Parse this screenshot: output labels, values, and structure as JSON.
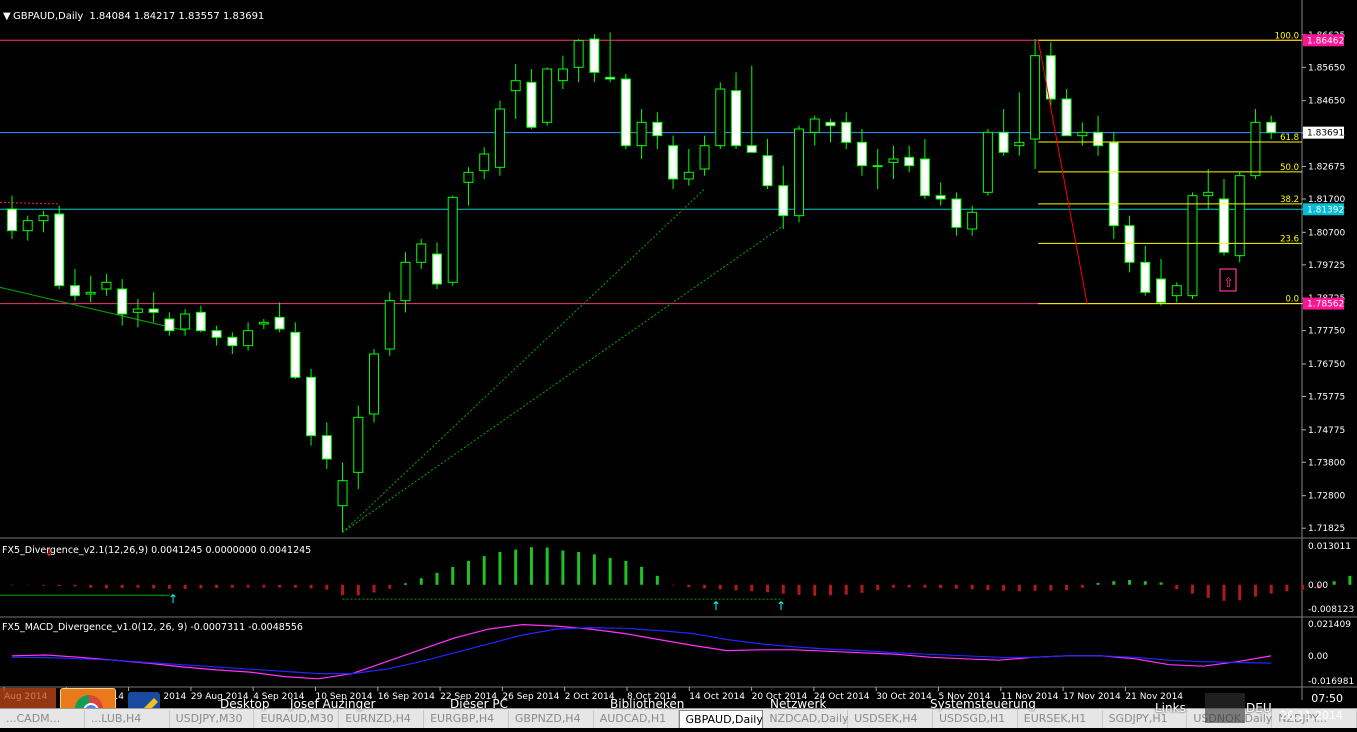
{
  "window": {
    "title": "GBPAUD,Daily",
    "ohlc": "1.84084 1.84217 1.83557 1.83691"
  },
  "colors": {
    "bull": "#00ff00",
    "body_fill": "#ffffff",
    "fib_line": "#ffff00",
    "hline_magenta": "#ff3377",
    "hline_blue": "#3399ff",
    "hline_cyan": "#00cccc",
    "hist_up": "#21c221",
    "hist_down": "#b0191d",
    "macd_main": "#ff33ff",
    "macd_signal": "#2424ff",
    "trend_dash": "#00aa00",
    "fib_trend": "#ff0000",
    "price_tag_magenta": "#ff1493",
    "price_tag_cyan": "#00bcd4"
  },
  "chart_data": [
    {
      "type": "candlestick",
      "title": "GBPAUD,Daily",
      "y_ticks": [
        "1.86625",
        "1.85650",
        "1.84650",
        "1.83691",
        "1.82675",
        "1.81700",
        "1.81392",
        "1.80700",
        "1.79725",
        "1.78725",
        "1.78562",
        "1.77750",
        "1.76750",
        "1.75775",
        "1.74775",
        "1.73800",
        "1.72800",
        "1.71825"
      ],
      "x_ticks": [
        "Aug 2014",
        "19 Aug 2014",
        "25 Aug 2014",
        "29 Aug 2014",
        "4 Sep 2014",
        "10 Sep 2014",
        "16 Sep 2014",
        "22 Sep 2014",
        "26 Sep 2014",
        "2 Oct 2014",
        "8 Oct 2014",
        "14 Oct 2014",
        "20 Oct 2014",
        "24 Oct 2014",
        "30 Oct 2014",
        "5 Nov 2014",
        "11 Nov 2014",
        "17 Nov 2014",
        "21 Nov 2014"
      ],
      "ylim": [
        1.7165,
        1.8695
      ],
      "current_price": "1.83691",
      "price_tags": [
        {
          "label": "1.86462",
          "value": 1.86462,
          "color": "magenta"
        },
        {
          "label": "1.83691",
          "value": 1.83691,
          "color": "white"
        },
        {
          "label": "1.81392",
          "value": 1.81392,
          "color": "cyan"
        },
        {
          "label": "1.78562",
          "value": 1.78562,
          "color": "magenta"
        }
      ],
      "horizontal_lines": [
        {
          "value": 1.86462,
          "color": "magenta"
        },
        {
          "value": 1.83691,
          "color": "blue"
        },
        {
          "value": 1.81392,
          "color": "cyan"
        },
        {
          "value": 1.78562,
          "color": "magenta"
        }
      ],
      "fibonacci": [
        {
          "label": "100.0",
          "value": 1.86462
        },
        {
          "label": "61.8",
          "value": 1.8341
        },
        {
          "label": "50.0",
          "value": 1.82512
        },
        {
          "label": "38.2",
          "value": 1.81553
        },
        {
          "label": "23.6",
          "value": 1.80369
        },
        {
          "label": "0.0",
          "value": 1.78562
        }
      ],
      "candles": [
        [
          1.814,
          1.818,
          1.805,
          1.8075
        ],
        [
          1.8075,
          1.812,
          1.8045,
          1.8105
        ],
        [
          1.8105,
          1.8135,
          1.807,
          1.812
        ],
        [
          1.8125,
          1.815,
          1.79,
          1.791
        ],
        [
          1.791,
          1.796,
          1.7865,
          1.788
        ],
        [
          1.7885,
          1.794,
          1.786,
          1.789
        ],
        [
          1.79,
          1.7945,
          1.788,
          1.792
        ],
        [
          1.79,
          1.793,
          1.779,
          1.7825
        ],
        [
          1.783,
          1.787,
          1.7785,
          1.784
        ],
        [
          1.784,
          1.789,
          1.78,
          1.783
        ],
        [
          1.781,
          1.783,
          1.776,
          1.7775
        ],
        [
          1.778,
          1.784,
          1.776,
          1.7825
        ],
        [
          1.783,
          1.785,
          1.777,
          1.7775
        ],
        [
          1.7775,
          1.779,
          1.773,
          1.7755
        ],
        [
          1.7755,
          1.777,
          1.7705,
          1.773
        ],
        [
          1.773,
          1.78,
          1.7715,
          1.7775
        ],
        [
          1.7795,
          1.781,
          1.778,
          1.78
        ],
        [
          1.7815,
          1.786,
          1.777,
          1.778
        ],
        [
          1.777,
          1.78,
          1.763,
          1.7635
        ],
        [
          1.7635,
          1.766,
          1.743,
          1.746
        ],
        [
          1.746,
          1.75,
          1.736,
          1.739
        ],
        [
          1.725,
          1.738,
          1.717,
          1.7325
        ],
        [
          1.735,
          1.755,
          1.73,
          1.7515
        ],
        [
          1.7525,
          1.772,
          1.75,
          1.7705
        ],
        [
          1.772,
          1.789,
          1.77,
          1.7865
        ],
        [
          1.7865,
          1.801,
          1.783,
          1.798
        ],
        [
          1.798,
          1.805,
          1.796,
          1.8035
        ],
        [
          1.8005,
          1.804,
          1.79,
          1.7915
        ],
        [
          1.792,
          1.818,
          1.791,
          1.8175
        ],
        [
          1.822,
          1.8265,
          1.815,
          1.825
        ],
        [
          1.8255,
          1.8325,
          1.823,
          1.8305
        ],
        [
          1.8265,
          1.8465,
          1.824,
          1.844
        ],
        [
          1.8495,
          1.8575,
          1.841,
          1.8525
        ],
        [
          1.852,
          1.856,
          1.838,
          1.8385
        ],
        [
          1.84,
          1.8565,
          1.839,
          1.856
        ],
        [
          1.8525,
          1.86,
          1.85,
          1.856
        ],
        [
          1.8565,
          1.865,
          1.852,
          1.8645
        ],
        [
          1.865,
          1.8665,
          1.852,
          1.855
        ],
        [
          1.8535,
          1.867,
          1.852,
          1.853
        ],
        [
          1.853,
          1.8545,
          1.832,
          1.833
        ],
        [
          1.833,
          1.844,
          1.829,
          1.84
        ],
        [
          1.84,
          1.843,
          1.832,
          1.836
        ],
        [
          1.833,
          1.836,
          1.82,
          1.823
        ],
        [
          1.823,
          1.832,
          1.821,
          1.825
        ],
        [
          1.826,
          1.836,
          1.824,
          1.833
        ],
        [
          1.833,
          1.852,
          1.832,
          1.85
        ],
        [
          1.8495,
          1.855,
          1.832,
          1.833
        ],
        [
          1.833,
          1.857,
          1.831,
          1.831
        ],
        [
          1.83,
          1.835,
          1.82,
          1.821
        ],
        [
          1.821,
          1.827,
          1.808,
          1.812
        ],
        [
          1.812,
          1.839,
          1.81,
          1.838
        ],
        [
          1.837,
          1.842,
          1.833,
          1.841
        ],
        [
          1.84,
          1.841,
          1.834,
          1.839
        ],
        [
          1.84,
          1.843,
          1.832,
          1.834
        ],
        [
          1.834,
          1.838,
          1.824,
          1.827
        ],
        [
          1.827,
          1.832,
          1.82,
          1.827
        ],
        [
          1.828,
          1.833,
          1.823,
          1.829
        ],
        [
          1.8295,
          1.833,
          1.825,
          1.827
        ],
        [
          1.829,
          1.835,
          1.817,
          1.818
        ],
        [
          1.818,
          1.822,
          1.815,
          1.817
        ],
        [
          1.817,
          1.819,
          1.806,
          1.8085
        ],
        [
          1.808,
          1.815,
          1.806,
          1.813
        ],
        [
          1.819,
          1.838,
          1.818,
          1.837
        ],
        [
          1.837,
          1.844,
          1.83,
          1.831
        ],
        [
          1.833,
          1.849,
          1.83,
          1.834
        ],
        [
          1.835,
          1.865,
          1.826,
          1.86
        ],
        [
          1.86,
          1.864,
          1.845,
          1.847
        ],
        [
          1.847,
          1.85,
          1.836,
          1.836
        ],
        [
          1.836,
          1.84,
          1.833,
          1.837
        ],
        [
          1.837,
          1.842,
          1.83,
          1.833
        ],
        [
          1.834,
          1.837,
          1.805,
          1.809
        ],
        [
          1.809,
          1.812,
          1.795,
          1.798
        ],
        [
          1.798,
          1.803,
          1.788,
          1.789
        ],
        [
          1.793,
          1.799,
          1.785,
          1.786
        ],
        [
          1.788,
          1.792,
          1.786,
          1.791
        ],
        [
          1.788,
          1.819,
          1.787,
          1.818
        ],
        [
          1.818,
          1.826,
          1.814,
          1.819
        ],
        [
          1.817,
          1.823,
          1.8,
          1.801
        ],
        [
          1.8,
          1.825,
          1.798,
          1.824
        ],
        [
          1.824,
          1.844,
          1.823,
          1.84
        ],
        [
          1.84,
          1.842,
          1.835,
          1.8369
        ]
      ]
    },
    {
      "type": "bar",
      "title": "FX5_Divergence_v2.1(12,26,9) 0.0041245 0.0000000 0.0041245",
      "y_ticks": [
        "0.013011",
        "0.00",
        "-0.008123"
      ],
      "ylim": [
        -0.008123,
        0.013011
      ],
      "values": [
        -0.0002,
        -0.0001,
        -0.0003,
        -0.0004,
        -0.0005,
        -0.001,
        -0.0012,
        -0.0011,
        -0.001,
        -0.0012,
        -0.0013,
        -0.0014,
        -0.0012,
        -0.0011,
        -0.001,
        -0.0009,
        -0.0009,
        -0.0009,
        -0.001,
        -0.0012,
        -0.0016,
        -0.0035,
        -0.0036,
        -0.0026,
        -0.0013,
        0.0005,
        0.0022,
        0.004,
        0.006,
        0.008,
        0.0096,
        0.011,
        0.0118,
        0.0126,
        0.0125,
        0.0115,
        0.011,
        0.0102,
        0.009,
        0.008,
        0.006,
        0.003,
        -0.0002,
        -0.0008,
        -0.0012,
        -0.0015,
        -0.0019,
        -0.0022,
        -0.0025,
        -0.003,
        -0.0034,
        -0.0037,
        -0.0035,
        -0.0033,
        -0.0027,
        -0.0018,
        -0.001,
        -0.0009,
        -0.001,
        -0.0011,
        -0.0013,
        -0.0015,
        -0.0018,
        -0.002,
        -0.0022,
        -0.002,
        -0.0019,
        -0.0018,
        -0.001,
        0.0006,
        0.0012,
        0.0016,
        0.0012,
        0.0008,
        -0.0015,
        -0.003,
        -0.0044,
        -0.0054,
        -0.0052,
        -0.004,
        -0.003,
        -0.0022,
        -0.0016,
        -0.0012,
        0.0012,
        0.003,
        0.0041245
      ]
    },
    {
      "type": "line",
      "title": "FX5_MACD_Divergence_v1.0(12, 26, 9) -0.0007311 -0.0048556",
      "y_ticks": [
        "0.021409",
        "0.00",
        "-0.016981"
      ],
      "ylim": [
        -0.016981,
        0.021409
      ],
      "series": [
        {
          "values": [
            0.0,
            0.0005,
            -0.001,
            -0.003,
            -0.005,
            -0.0075,
            -0.0095,
            -0.011,
            -0.014,
            -0.0155,
            -0.012,
            -0.004,
            0.004,
            0.012,
            0.018,
            0.021,
            0.02,
            0.018,
            0.015,
            0.011,
            0.007,
            0.0035,
            0.004,
            0.004,
            0.003,
            0.002,
            0.001,
            -0.001,
            -0.002,
            -0.003,
            -0.001,
            0.0,
            0.0,
            -0.002,
            -0.006,
            -0.007,
            -0.004,
            0.0
          ]
        },
        {
          "values": [
            -0.001,
            -0.0012,
            -0.002,
            -0.003,
            -0.0045,
            -0.006,
            -0.0075,
            -0.009,
            -0.0105,
            -0.012,
            -0.012,
            -0.009,
            -0.004,
            0.002,
            0.008,
            0.014,
            0.018,
            0.019,
            0.0185,
            0.017,
            0.015,
            0.011,
            0.008,
            0.006,
            0.0045,
            0.0035,
            0.002,
            0.001,
            0.0,
            -0.001,
            -0.001,
            0.0,
            0.0,
            -0.001,
            -0.003,
            -0.004,
            -0.0045,
            -0.0049
          ]
        }
      ]
    }
  ],
  "taskbar": {
    "items": [
      "Desktop",
      "Josef Auzinger",
      "Dieser PC",
      "Bibliotheken",
      "Netzwerk",
      "Systemsteuerung",
      "Links"
    ],
    "language": "DEU",
    "time": "07:50",
    "date": "26.11.2014"
  },
  "tabs": [
    "...CADM...",
    "...LUB,H4",
    "USDJPY,M30",
    "EURAUD,M30",
    "EURNZD,H4",
    "EURGBP,H4",
    "GBPNZD,H4",
    "AUDCAD,H1",
    "GBPAUD,Daily",
    "NZDCAD,Daily",
    "USDSEK,H4",
    "USDSGD,H1",
    "EURSEK,H1",
    "SGDJPY,H1",
    "USDNOK,Daily",
    "NZDJPY..."
  ],
  "active_tab": "GBPAUD,Daily"
}
